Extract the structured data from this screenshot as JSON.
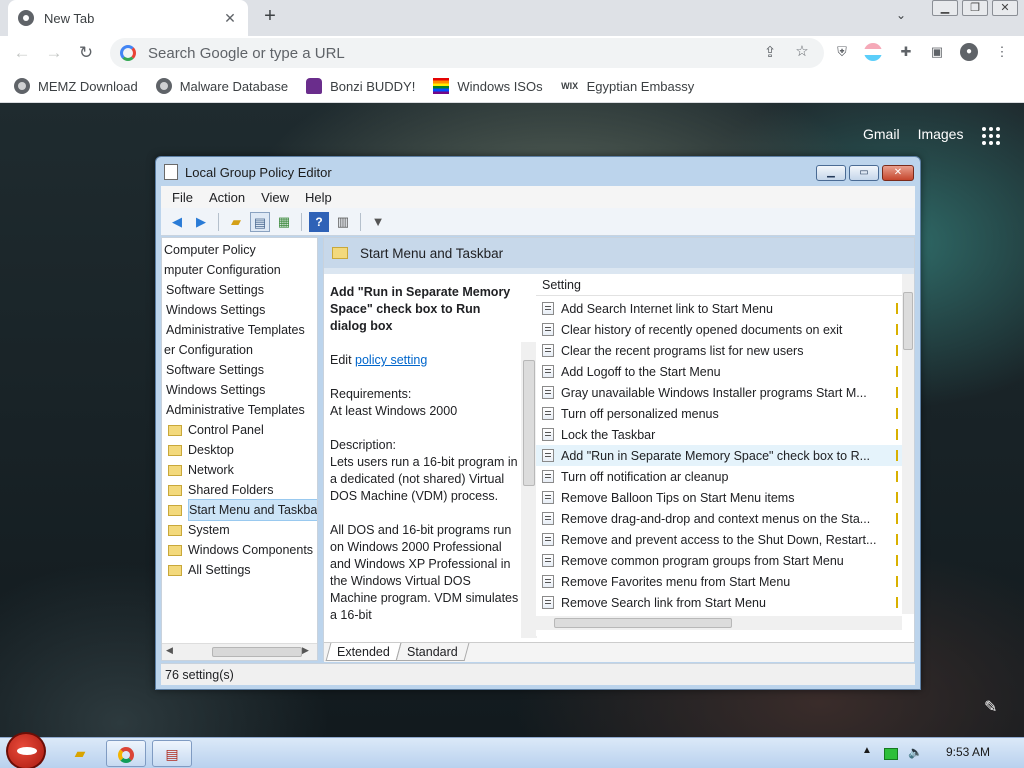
{
  "browser": {
    "tab_title": "New Tab",
    "tab_close": "✕",
    "new_tab": "+",
    "tab_search": "⌄",
    "window_buttons": [
      "▁",
      "❐",
      "✕"
    ],
    "omnibox_placeholder": "Search Google or type a URL",
    "bookmarks": [
      {
        "label": "MEMZ Download",
        "icon": "globe-icon"
      },
      {
        "label": "Malware Database",
        "icon": "globe-icon"
      },
      {
        "label": "Bonzi BUDDY!",
        "icon": "purple-gorilla-icon"
      },
      {
        "label": "Windows ISOs",
        "icon": "rainbow-flag-icon"
      },
      {
        "label": "Egyptian Embassy",
        "icon": "wix-icon"
      }
    ],
    "wix": "WIX"
  },
  "newtab_page": {
    "links": [
      "Gmail",
      "Images"
    ]
  },
  "gpe": {
    "title": "Local Group Policy Editor",
    "menu": [
      "File",
      "Action",
      "View",
      "Help"
    ],
    "tree": [
      {
        "label": "Computer Policy",
        "indent": 0,
        "folder": false
      },
      {
        "label": "mputer Configuration",
        "indent": 0,
        "folder": false
      },
      {
        "label": "Software Settings",
        "indent": 1,
        "folder": false
      },
      {
        "label": "Windows Settings",
        "indent": 1,
        "folder": false
      },
      {
        "label": "Administrative Templates",
        "indent": 1,
        "folder": false
      },
      {
        "label": "er Configuration",
        "indent": 0,
        "folder": false
      },
      {
        "label": "Software Settings",
        "indent": 1,
        "folder": false
      },
      {
        "label": "Windows Settings",
        "indent": 1,
        "folder": false
      },
      {
        "label": "Administrative Templates",
        "indent": 1,
        "folder": false
      },
      {
        "label": "Control Panel",
        "indent": 2,
        "folder": true
      },
      {
        "label": "Desktop",
        "indent": 2,
        "folder": true
      },
      {
        "label": "Network",
        "indent": 2,
        "folder": true
      },
      {
        "label": "Shared Folders",
        "indent": 2,
        "folder": true
      },
      {
        "label": "Start Menu and Taskbar",
        "indent": 2,
        "folder": true,
        "selected": true
      },
      {
        "label": "System",
        "indent": 2,
        "folder": true
      },
      {
        "label": "Windows Components",
        "indent": 2,
        "folder": true
      },
      {
        "label": "All Settings",
        "indent": 2,
        "folder": true
      }
    ],
    "pane_title": "Start Menu and Taskbar",
    "desc": {
      "title": "Add \"Run in Separate Memory Space\" check box to Run dialog box",
      "edit_prefix": "Edit ",
      "edit_link": "policy setting ",
      "req_label": "Requirements:",
      "req_value": "At least Windows 2000",
      "desc_label": "Description:",
      "desc_text": "Lets users run a 16-bit program in a dedicated (not shared) Virtual DOS Machine (VDM) process.",
      "desc_text2": "All DOS and 16-bit programs run on Windows 2000 Professional and Windows XP Professional in the Windows Virtual DOS Machine program. VDM simulates a 16-bit"
    },
    "list_header": "Setting",
    "settings": [
      "Add Search Internet link to Start Menu",
      "Clear history of recently opened documents on exit",
      "Clear the recent programs list for new users",
      "Add Logoff to the Start Menu",
      "Gray unavailable Windows Installer programs Start M...",
      "Turn off personalized menus",
      "Lock the Taskbar",
      "Add \"Run in Separate Memory Space\" check box to R...",
      "Turn off notification ar  cleanup",
      "Remove Balloon Tips on Start Menu items",
      "Remove drag-and-drop and context menus on the Sta...",
      "Remove and prevent access to the Shut Down, Restart...",
      "Remove common program groups from Start Menu",
      "Remove Favorites menu from Start Menu",
      "Remove Search link from Start Menu"
    ],
    "highlighted_index": 7,
    "tabs": [
      "Extended",
      "Standard"
    ],
    "status": "76 setting(s)"
  },
  "taskbar": {
    "clock": "9:53 AM"
  }
}
